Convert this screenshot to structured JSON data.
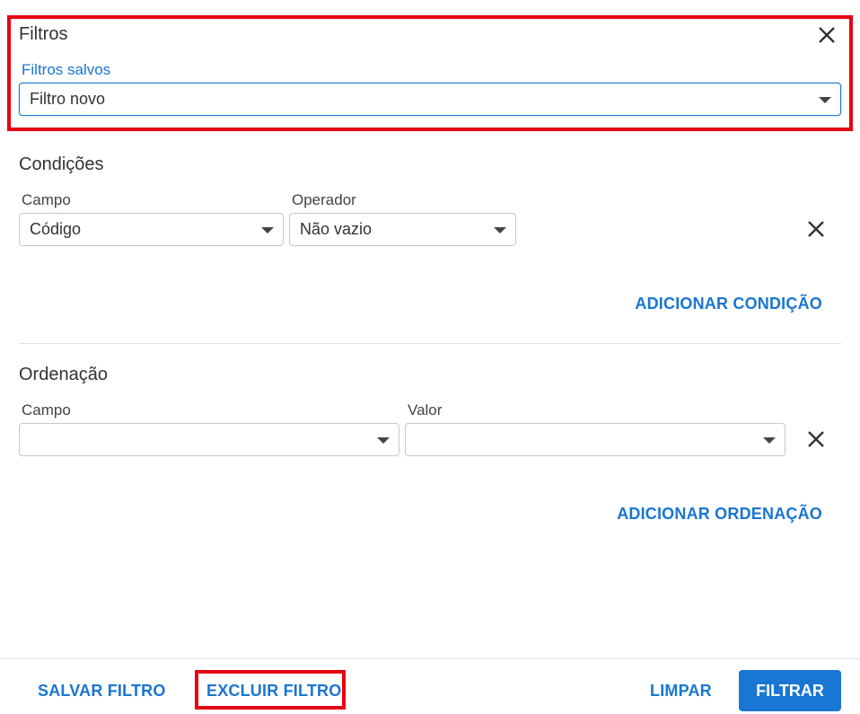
{
  "header": {
    "title": "Filtros"
  },
  "saved_filters": {
    "label": "Filtros salvos",
    "selected": "Filtro novo"
  },
  "conditions": {
    "title": "Condições",
    "field_label": "Campo",
    "operator_label": "Operador",
    "field_value": "Código",
    "operator_value": "Não vazio",
    "add_label": "ADICIONAR CONDIÇÃO"
  },
  "ordering": {
    "title": "Ordenação",
    "field_label": "Campo",
    "value_label": "Valor",
    "field_value": "",
    "value_value": "",
    "add_label": "ADICIONAR ORDENAÇÃO"
  },
  "footer": {
    "save_label": "SALVAR FILTRO",
    "delete_label": "EXCLUIR FILTRO",
    "clear_label": "LIMPAR",
    "filter_label": "FILTRAR"
  },
  "colors": {
    "accent": "#1976d2",
    "highlight": "#e60012"
  },
  "icons": {
    "close": "close-icon",
    "dropdown": "chevron-down-icon",
    "remove": "remove-icon"
  }
}
